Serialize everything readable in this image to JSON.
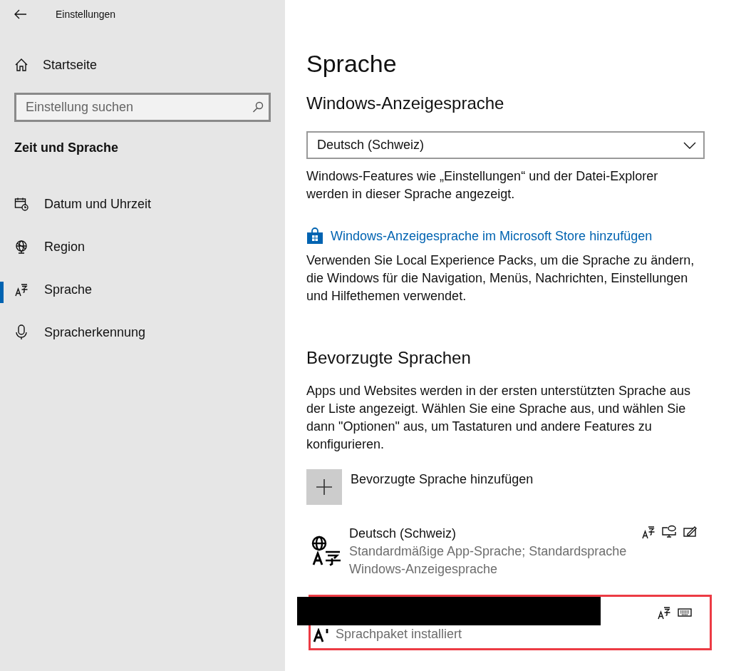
{
  "window": {
    "title": "Einstellungen"
  },
  "sidebar": {
    "home": "Startseite",
    "search": {
      "placeholder": "Einstellung suchen"
    },
    "section": "Zeit und Sprache",
    "items": [
      {
        "label": "Datum und Uhrzeit",
        "kind": "calendar",
        "selected": false
      },
      {
        "label": "Region",
        "kind": "globe",
        "selected": false
      },
      {
        "label": "Sprache",
        "kind": "language",
        "selected": true
      },
      {
        "label": "Spracherkennung",
        "kind": "microphone",
        "selected": false
      }
    ]
  },
  "main": {
    "title": "Sprache",
    "display_language": {
      "heading": "Windows-Anzeigesprache",
      "value": "Deutsch (Schweiz)",
      "description": "Windows-Features wie „Einstellungen“ und der Datei-Explorer werden in dieser Sprache angezeigt.",
      "store_link": "Windows-Anzeigesprache im Microsoft Store hinzufügen",
      "store_description": "Verwenden Sie Local Experience Packs, um die Sprache zu ändern, die Windows für die Navigation, Menüs, Nachrichten, Einstellungen und Hilfethemen verwendet."
    },
    "preferred": {
      "heading": "Bevorzugte Sprachen",
      "description": "Apps und Websites werden in der ersten unterstützten Sprache aus der Liste angezeigt. Wählen Sie eine Sprache aus, und wählen Sie dann \"Optionen\" aus, um Tastaturen und andere Features zu konfigurieren.",
      "add_label": "Bevorzugte Sprache hinzufügen",
      "languages": [
        {
          "name": "Deutsch (Schweiz)",
          "kind": "display",
          "detail": "Standardmäßige App-Sprache; Standardsprache Windows-Anzeigesprache",
          "features": [
            {
              "kind": "text"
            },
            {
              "kind": "speech"
            },
            {
              "kind": "handwriting"
            }
          ],
          "highlighted": false,
          "redacted": false
        },
        {
          "kind": "text",
          "detail": "Sprachpaket installiert",
          "features": [
            {
              "kind": "text"
            },
            {
              "kind": "keyboard"
            }
          ],
          "highlighted": true,
          "redacted": true
        }
      ]
    }
  }
}
